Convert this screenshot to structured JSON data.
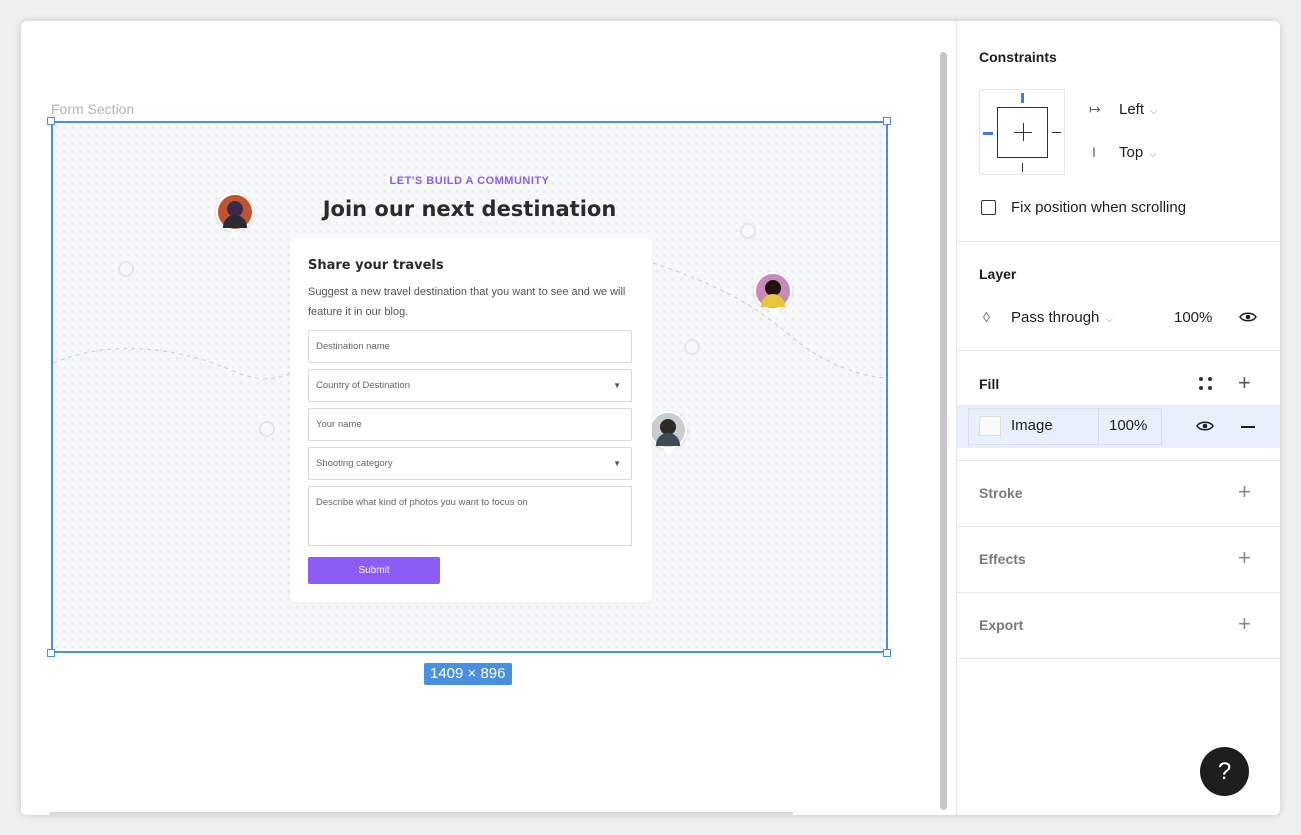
{
  "canvas": {
    "frame_label": "Form Section",
    "size_badge": "1409 × 896",
    "form": {
      "eyebrow": "LET'S BUILD A COMMUNITY",
      "headline": "Join our next destination",
      "card_title": "Share your travels",
      "card_description": "Suggest a new travel destination that you want to see and we will feature it in our blog.",
      "fields": [
        {
          "placeholder": "Destination name",
          "type": "text"
        },
        {
          "placeholder": "Country of Destination",
          "type": "select"
        },
        {
          "placeholder": "Your name",
          "type": "text"
        },
        {
          "placeholder": "Shooting category",
          "type": "select"
        },
        {
          "placeholder": "Describe what kind of photos you want to focus on",
          "type": "textarea"
        }
      ],
      "submit_label": "Submit",
      "accent_color": "#8b5cf6"
    }
  },
  "panel": {
    "constraints": {
      "title": "Constraints",
      "horizontal": "Left",
      "vertical": "Top",
      "fix_position_label": "Fix position when scrolling",
      "fix_position_checked": false
    },
    "layer": {
      "title": "Layer",
      "blend_mode": "Pass through",
      "opacity": "100%"
    },
    "fill": {
      "title": "Fill",
      "type": "Image",
      "opacity": "100%"
    },
    "stroke": {
      "title": "Stroke"
    },
    "effects": {
      "title": "Effects"
    },
    "export": {
      "title": "Export"
    },
    "help_label": "?"
  },
  "colors": {
    "selection": "#4a90e2",
    "selected_row": "#e7f0fb"
  }
}
